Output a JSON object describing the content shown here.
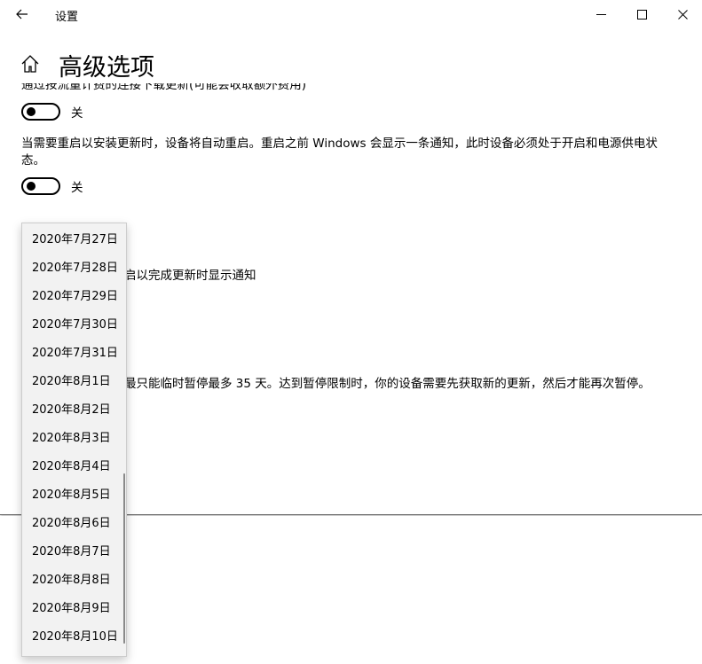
{
  "window": {
    "app_title": "设置",
    "page_title": "高级选项"
  },
  "settings": {
    "metered_text": "通过按流量计费的连接下载更新(可能会收取额外费用)",
    "metered_toggle_label": "关",
    "restart_text_line1": "当需要重启以安装更新时，设备将自动重启。重启之前 Windows 会显示一条通知，此时设备必须处于开启和电源供电状",
    "restart_text_line2": "态。",
    "restart_toggle_label": "关",
    "notify_text_partial": "启以完成更新时显示通知",
    "pause_text_partial": "最只能临时暂停最多 35 天。达到暂停限制时，你的设备需要先获取新的更新，然后才能再次暂停。"
  },
  "date_dropdown": {
    "options": [
      "2020年7月27日",
      "2020年7月28日",
      "2020年7月29日",
      "2020年7月30日",
      "2020年7月31日",
      "2020年8月1日",
      "2020年8月2日",
      "2020年8月3日",
      "2020年8月4日",
      "2020年8月5日",
      "2020年8月6日",
      "2020年8月7日",
      "2020年8月8日",
      "2020年8月9日",
      "2020年8月10日"
    ]
  },
  "icons": {
    "back": "back-arrow-icon",
    "minimize": "minimize-icon",
    "maximize": "maximize-icon",
    "close": "close-icon",
    "home": "home-icon"
  }
}
